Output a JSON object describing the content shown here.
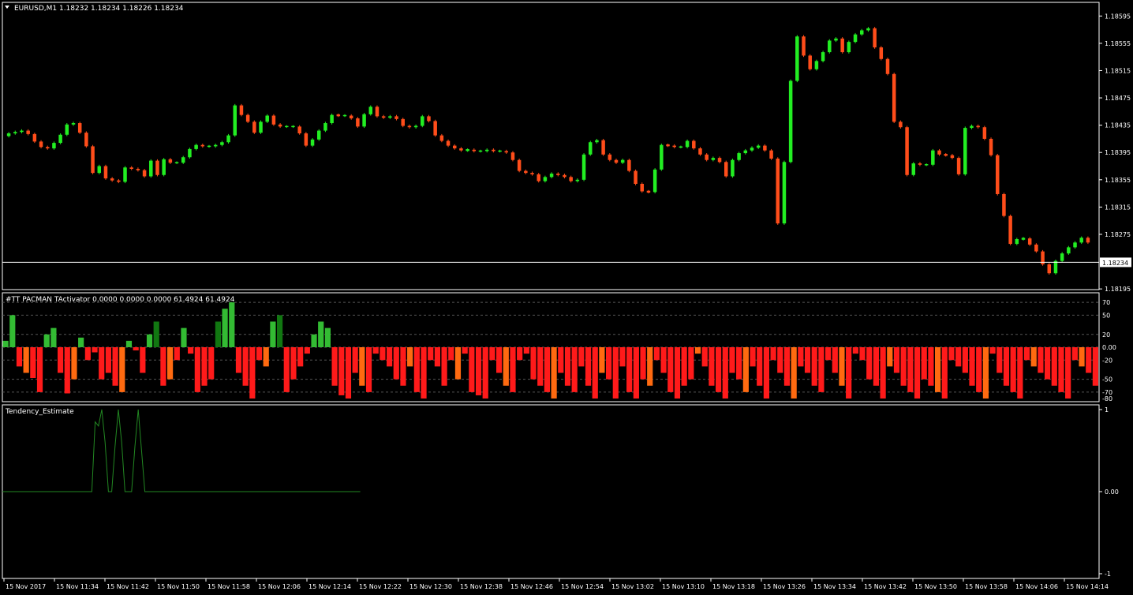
{
  "window": {
    "symbol_label": "EURUSD,M1",
    "ohlc_label": "1.18232 1.18234 1.18226 1.18234",
    "current_price_label": "1.18234"
  },
  "colors": {
    "background": "#000000",
    "bull": "#22ee22",
    "bear": "#ff4d1a",
    "hist_green": "#33bb33",
    "hist_dark_green": "#117711",
    "hist_red": "#ff1a1a",
    "hist_orange": "#ff6a10",
    "line": "#228822",
    "frame": "#ffffff",
    "grid": "#555555"
  },
  "panels": {
    "indicator1_label": "#TT PACMAN TActivator 0.0000 0.0000 0.0000 61.4924 61.4924",
    "indicator2_label": "Tendency_Estimate"
  },
  "chart_data": [
    {
      "type": "candlestick",
      "title": "EURUSD,M1",
      "ylim": [
        1.18194,
        1.18615
      ],
      "y_ticks": [
        "1.18595",
        "1.18555",
        "1.18515",
        "1.18475",
        "1.18435",
        "1.18395",
        "1.18355",
        "1.18315",
        "1.18275",
        "1.18234",
        "1.18195"
      ],
      "current_price": 1.18234,
      "close": [
        1.18423,
        1.18425,
        1.18427,
        1.18422,
        1.18411,
        1.18403,
        1.18401,
        1.18409,
        1.18421,
        1.18436,
        1.18438,
        1.18424,
        1.18404,
        1.18365,
        1.18375,
        1.18357,
        1.18354,
        1.18352,
        1.18373,
        1.18371,
        1.18369,
        1.1836,
        1.18383,
        1.18362,
        1.18385,
        1.1838,
        1.1838,
        1.18388,
        1.184,
        1.18406,
        1.18404,
        1.18404,
        1.18406,
        1.1841,
        1.1842,
        1.18464,
        1.1845,
        1.1844,
        1.18424,
        1.1844,
        1.18449,
        1.18436,
        1.18433,
        1.18433,
        1.18433,
        1.18423,
        1.18405,
        1.18414,
        1.18427,
        1.18438,
        1.1845,
        1.18449,
        1.18449,
        1.18445,
        1.18433,
        1.18451,
        1.18462,
        1.18448,
        1.18446,
        1.18448,
        1.18444,
        1.18434,
        1.18432,
        1.18434,
        1.18448,
        1.18441,
        1.1842,
        1.18412,
        1.18405,
        1.18401,
        1.18398,
        1.18399,
        1.18397,
        1.18397,
        1.18399,
        1.18397,
        1.18397,
        1.18395,
        1.18384,
        1.18368,
        1.18365,
        1.18363,
        1.18353,
        1.18359,
        1.18364,
        1.18362,
        1.18359,
        1.18353,
        1.18355,
        1.18392,
        1.1841,
        1.18413,
        1.18392,
        1.18384,
        1.1838,
        1.18384,
        1.18368,
        1.18349,
        1.18338,
        1.18337,
        1.1837,
        1.18406,
        1.18405,
        1.18403,
        1.18403,
        1.18412,
        1.18401,
        1.18392,
        1.18384,
        1.18387,
        1.18381,
        1.1836,
        1.18384,
        1.18394,
        1.18398,
        1.18402,
        1.18405,
        1.18398,
        1.18386,
        1.18291,
        1.18381,
        1.185,
        1.18565,
        1.18537,
        1.18517,
        1.18529,
        1.18542,
        1.18559,
        1.18562,
        1.18542,
        1.18557,
        1.18568,
        1.18574,
        1.18577,
        1.18549,
        1.18532,
        1.1851,
        1.1844,
        1.18432,
        1.18362,
        1.18379,
        1.18377,
        1.18377,
        1.18398,
        1.18392,
        1.18391,
        1.18387,
        1.18363,
        1.18431,
        1.18434,
        1.18432,
        1.18415,
        1.18391,
        1.18334,
        1.18302,
        1.18261,
        1.18268,
        1.18269,
        1.1826,
        1.1825,
        1.18231,
        1.18218,
        1.18236,
        1.18247,
        1.18256,
        1.18263,
        1.1827,
        1.18263
      ]
    },
    {
      "type": "bar",
      "title": "#TT PACMAN TActivator",
      "ylim": [
        -80,
        80
      ],
      "y_ticks": [
        "70",
        "50",
        "20",
        "0.00",
        "-20",
        "-50",
        "-70",
        "-80"
      ],
      "levels": [
        70,
        50,
        20,
        0,
        -20,
        -50,
        -70
      ],
      "values": [
        10,
        50,
        -30,
        -40,
        -48,
        -70,
        20,
        30,
        -40,
        -72,
        -50,
        15,
        -20,
        -8,
        -50,
        -40,
        -60,
        -70,
        10,
        -5,
        -40,
        20,
        40,
        -60,
        -50,
        -20,
        30,
        -10,
        -70,
        -60,
        -50,
        40,
        60,
        70,
        -40,
        -60,
        -80,
        -20,
        -30,
        40,
        50,
        -70,
        -50,
        -30,
        -10,
        20,
        40,
        30,
        -60,
        -75,
        -80,
        -40,
        -60,
        -70,
        -10,
        -20,
        -30,
        -50,
        -60,
        -30,
        -70,
        -80,
        -20,
        -30,
        -60,
        -20,
        -50,
        -10,
        -70,
        -75,
        -80,
        -20,
        -40,
        -60,
        -70,
        -20,
        -10,
        -50,
        -60,
        -70,
        -80,
        -40,
        -60,
        -70,
        -30,
        -60,
        -80,
        -40,
        -50,
        -80,
        -30,
        -70,
        -80,
        -50,
        -60,
        -20,
        -40,
        -70,
        -80,
        -60,
        -50,
        -10,
        -30,
        -60,
        -70,
        -80,
        -40,
        -50,
        -70,
        -30,
        -60,
        -80,
        -20,
        -40,
        -60,
        -80,
        -30,
        -40,
        -60,
        -70,
        -20,
        -40,
        -60,
        -80,
        -10,
        -20,
        -50,
        -60,
        -80,
        -30,
        -40,
        -60,
        -70,
        -80,
        -50,
        -60,
        -70,
        -80,
        -20,
        -30,
        -40,
        -60,
        -70,
        -80,
        -10,
        -40,
        -60,
        -70,
        -80,
        -20,
        -30,
        -40,
        -50,
        -60,
        -70,
        -80,
        -20,
        -30,
        -40,
        -60
      ],
      "note_legend": ""
    },
    {
      "type": "line",
      "title": "Tendency_Estimate",
      "ylim": [
        -1,
        1
      ],
      "y_ticks": [
        "1",
        "0.00",
        "-1"
      ],
      "values": [
        0,
        0,
        0,
        0,
        0,
        0,
        0,
        0,
        0,
        0,
        0,
        0,
        0,
        0,
        0,
        0,
        0,
        0,
        0,
        0,
        0,
        0,
        0,
        0,
        0,
        0,
        0,
        0,
        0.85,
        0.8,
        1,
        0.6,
        0,
        0,
        0.55,
        1,
        0.6,
        0,
        0,
        0,
        0.55,
        1,
        0.5,
        0,
        0,
        0,
        0,
        0,
        0,
        0,
        0,
        0,
        0,
        0,
        0,
        0,
        0,
        0,
        0,
        0,
        0,
        0,
        0,
        0,
        0,
        0,
        0,
        0,
        0,
        0,
        0,
        0,
        0,
        0,
        0,
        0,
        0,
        0,
        0,
        0,
        0,
        0,
        0,
        0,
        0,
        0,
        0,
        0,
        0,
        0,
        0,
        0,
        0,
        0,
        0,
        0,
        0,
        0,
        0,
        0,
        0,
        0,
        0,
        0,
        0,
        0,
        0,
        0,
        0
      ]
    }
  ],
  "x_axis_labels": [
    "15 Nov 2017",
    "15 Nov 11:34",
    "15 Nov 11:42",
    "15 Nov 11:50",
    "15 Nov 11:58",
    "15 Nov 12:06",
    "15 Nov 12:14",
    "15 Nov 12:22",
    "15 Nov 12:30",
    "15 Nov 12:38",
    "15 Nov 12:46",
    "15 Nov 12:54",
    "15 Nov 13:02",
    "15 Nov 13:10",
    "15 Nov 13:18",
    "15 Nov 13:26",
    "15 Nov 13:34",
    "15 Nov 13:42",
    "15 Nov 13:50",
    "15 Nov 13:58",
    "15 Nov 14:06",
    "15 Nov 14:14"
  ]
}
